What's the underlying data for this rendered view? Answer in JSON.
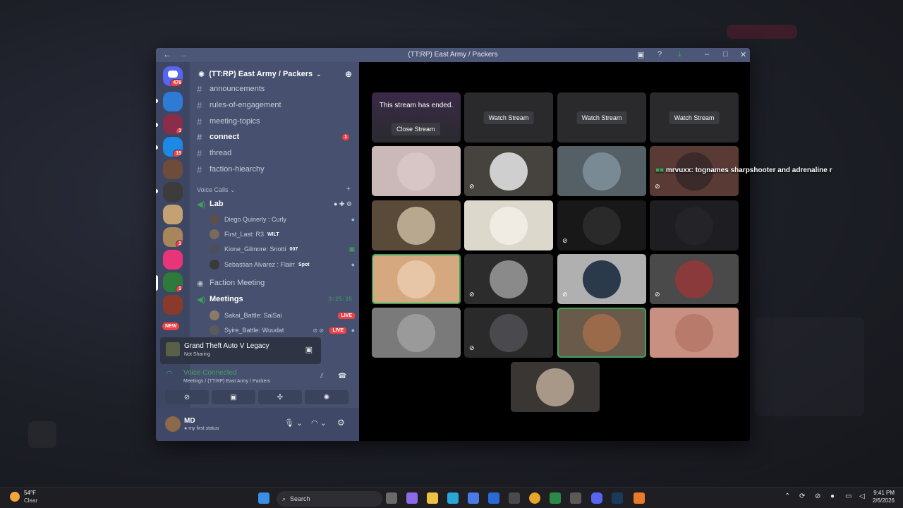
{
  "window": {
    "title": "(TT:RP) East Army / Packers",
    "back_icon": "arrow-left-icon",
    "forward_icon": "arrow-right-icon"
  },
  "servers": [
    {
      "name": "discord-home",
      "badge": "476",
      "color": "#5865f2"
    },
    {
      "name": "server-2",
      "badge": "",
      "color": "#2e7bd6"
    },
    {
      "name": "server-3",
      "badge": "1",
      "color": "#8b2d4a"
    },
    {
      "name": "server-4",
      "badge": "15",
      "color": "#1e88e5"
    },
    {
      "name": "server-5",
      "badge": "",
      "color": "#6d4c3b"
    },
    {
      "name": "server-6",
      "badge": "",
      "color": "#3c3c3c"
    },
    {
      "name": "server-7",
      "badge": "",
      "color": "#c4a172"
    },
    {
      "name": "server-8",
      "badge": "1",
      "color": "#a8855a"
    },
    {
      "name": "server-9",
      "badge": "",
      "color": "#e8357a"
    },
    {
      "name": "server-10",
      "badge": "1",
      "color": "#2d7a3a"
    },
    {
      "name": "server-11",
      "badge": "",
      "color": "#8a3a2a"
    },
    {
      "name": "new-server",
      "badge": "NEW",
      "color": "#e8357a"
    }
  ],
  "guild": {
    "name": "(TT:RP) East Army / Packers"
  },
  "text_channels": [
    {
      "name": "announcements",
      "bold": false,
      "badge": ""
    },
    {
      "name": "rules-of-engagement",
      "bold": false,
      "badge": ""
    },
    {
      "name": "meeting-topics",
      "bold": false,
      "badge": ""
    },
    {
      "name": "connect",
      "bold": true,
      "badge": "1"
    },
    {
      "name": "thread",
      "bold": false,
      "badge": ""
    },
    {
      "name": "faction-hiearchy",
      "bold": false,
      "badge": ""
    }
  ],
  "voice_category": "Voice Calls",
  "voice_channels": {
    "lab": {
      "name": "Lab",
      "members": [
        {
          "name": "Diego Quinerly : Curly",
          "tag": ""
        },
        {
          "name": "First_Last: R3",
          "tag": "WILT"
        },
        {
          "name": "Kione_Gilmore: Snotti",
          "tag": "007"
        },
        {
          "name": "Sebastian Alvarez : Flairr",
          "tag": "Spot"
        }
      ]
    },
    "faction_meeting": {
      "name": "Faction Meeting"
    },
    "meetings": {
      "name": "Meetings",
      "timer": "3:25:35",
      "members": [
        {
          "name": "Sakai_Battle: SaiSai",
          "live": "LIVE"
        },
        {
          "name": "Syire_Battle: Wuudat",
          "live": "LIVE"
        }
      ]
    }
  },
  "activity": {
    "game": "Grand Theft Auto V Legacy",
    "status": "Not Sharing"
  },
  "voice_status": {
    "title": "Voice Connected",
    "location": "Meetings / (TT:RP) East Army / Packers"
  },
  "user": {
    "name": "MD",
    "status": "my first status"
  },
  "stage": {
    "ended_text": "This stream has ended.",
    "close_label": "Close Stream",
    "watch_label": "Watch Stream",
    "chat_user": "mrvuxx:",
    "chat_message": "tognames sharpshooter and adrenaline r"
  },
  "taskbar": {
    "weather_temp": "54°F",
    "weather_desc": "Clear",
    "search_label": "Search",
    "time": "9:41 PM",
    "date": "2/6/2026"
  }
}
